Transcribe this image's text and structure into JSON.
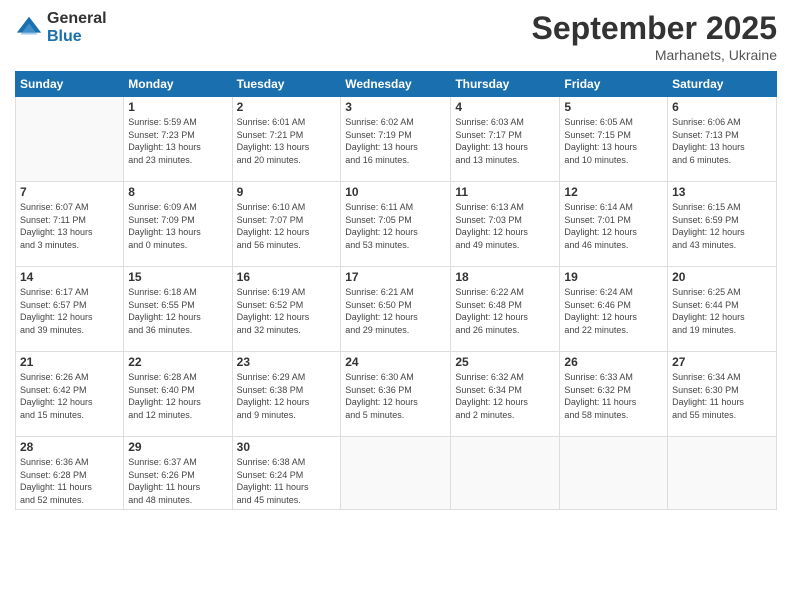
{
  "logo": {
    "general": "General",
    "blue": "Blue"
  },
  "header": {
    "month": "September 2025",
    "location": "Marhanets, Ukraine"
  },
  "weekdays": [
    "Sunday",
    "Monday",
    "Tuesday",
    "Wednesday",
    "Thursday",
    "Friday",
    "Saturday"
  ],
  "weeks": [
    [
      {
        "day": "",
        "info": ""
      },
      {
        "day": "1",
        "info": "Sunrise: 5:59 AM\nSunset: 7:23 PM\nDaylight: 13 hours\nand 23 minutes."
      },
      {
        "day": "2",
        "info": "Sunrise: 6:01 AM\nSunset: 7:21 PM\nDaylight: 13 hours\nand 20 minutes."
      },
      {
        "day": "3",
        "info": "Sunrise: 6:02 AM\nSunset: 7:19 PM\nDaylight: 13 hours\nand 16 minutes."
      },
      {
        "day": "4",
        "info": "Sunrise: 6:03 AM\nSunset: 7:17 PM\nDaylight: 13 hours\nand 13 minutes."
      },
      {
        "day": "5",
        "info": "Sunrise: 6:05 AM\nSunset: 7:15 PM\nDaylight: 13 hours\nand 10 minutes."
      },
      {
        "day": "6",
        "info": "Sunrise: 6:06 AM\nSunset: 7:13 PM\nDaylight: 13 hours\nand 6 minutes."
      }
    ],
    [
      {
        "day": "7",
        "info": "Sunrise: 6:07 AM\nSunset: 7:11 PM\nDaylight: 13 hours\nand 3 minutes."
      },
      {
        "day": "8",
        "info": "Sunrise: 6:09 AM\nSunset: 7:09 PM\nDaylight: 13 hours\nand 0 minutes."
      },
      {
        "day": "9",
        "info": "Sunrise: 6:10 AM\nSunset: 7:07 PM\nDaylight: 12 hours\nand 56 minutes."
      },
      {
        "day": "10",
        "info": "Sunrise: 6:11 AM\nSunset: 7:05 PM\nDaylight: 12 hours\nand 53 minutes."
      },
      {
        "day": "11",
        "info": "Sunrise: 6:13 AM\nSunset: 7:03 PM\nDaylight: 12 hours\nand 49 minutes."
      },
      {
        "day": "12",
        "info": "Sunrise: 6:14 AM\nSunset: 7:01 PM\nDaylight: 12 hours\nand 46 minutes."
      },
      {
        "day": "13",
        "info": "Sunrise: 6:15 AM\nSunset: 6:59 PM\nDaylight: 12 hours\nand 43 minutes."
      }
    ],
    [
      {
        "day": "14",
        "info": "Sunrise: 6:17 AM\nSunset: 6:57 PM\nDaylight: 12 hours\nand 39 minutes."
      },
      {
        "day": "15",
        "info": "Sunrise: 6:18 AM\nSunset: 6:55 PM\nDaylight: 12 hours\nand 36 minutes."
      },
      {
        "day": "16",
        "info": "Sunrise: 6:19 AM\nSunset: 6:52 PM\nDaylight: 12 hours\nand 32 minutes."
      },
      {
        "day": "17",
        "info": "Sunrise: 6:21 AM\nSunset: 6:50 PM\nDaylight: 12 hours\nand 29 minutes."
      },
      {
        "day": "18",
        "info": "Sunrise: 6:22 AM\nSunset: 6:48 PM\nDaylight: 12 hours\nand 26 minutes."
      },
      {
        "day": "19",
        "info": "Sunrise: 6:24 AM\nSunset: 6:46 PM\nDaylight: 12 hours\nand 22 minutes."
      },
      {
        "day": "20",
        "info": "Sunrise: 6:25 AM\nSunset: 6:44 PM\nDaylight: 12 hours\nand 19 minutes."
      }
    ],
    [
      {
        "day": "21",
        "info": "Sunrise: 6:26 AM\nSunset: 6:42 PM\nDaylight: 12 hours\nand 15 minutes."
      },
      {
        "day": "22",
        "info": "Sunrise: 6:28 AM\nSunset: 6:40 PM\nDaylight: 12 hours\nand 12 minutes."
      },
      {
        "day": "23",
        "info": "Sunrise: 6:29 AM\nSunset: 6:38 PM\nDaylight: 12 hours\nand 9 minutes."
      },
      {
        "day": "24",
        "info": "Sunrise: 6:30 AM\nSunset: 6:36 PM\nDaylight: 12 hours\nand 5 minutes."
      },
      {
        "day": "25",
        "info": "Sunrise: 6:32 AM\nSunset: 6:34 PM\nDaylight: 12 hours\nand 2 minutes."
      },
      {
        "day": "26",
        "info": "Sunrise: 6:33 AM\nSunset: 6:32 PM\nDaylight: 11 hours\nand 58 minutes."
      },
      {
        "day": "27",
        "info": "Sunrise: 6:34 AM\nSunset: 6:30 PM\nDaylight: 11 hours\nand 55 minutes."
      }
    ],
    [
      {
        "day": "28",
        "info": "Sunrise: 6:36 AM\nSunset: 6:28 PM\nDaylight: 11 hours\nand 52 minutes."
      },
      {
        "day": "29",
        "info": "Sunrise: 6:37 AM\nSunset: 6:26 PM\nDaylight: 11 hours\nand 48 minutes."
      },
      {
        "day": "30",
        "info": "Sunrise: 6:38 AM\nSunset: 6:24 PM\nDaylight: 11 hours\nand 45 minutes."
      },
      {
        "day": "",
        "info": ""
      },
      {
        "day": "",
        "info": ""
      },
      {
        "day": "",
        "info": ""
      },
      {
        "day": "",
        "info": ""
      }
    ]
  ]
}
